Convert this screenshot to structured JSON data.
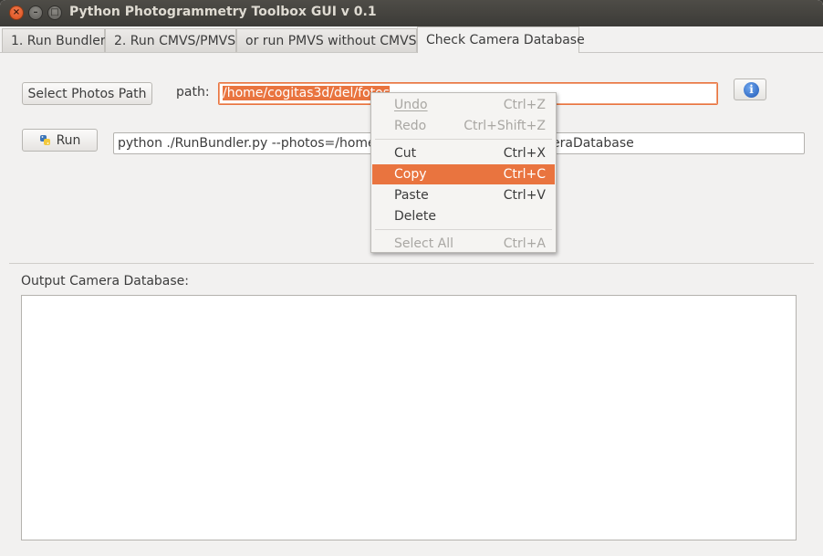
{
  "window": {
    "title": "Python Photogrammetry Toolbox GUI v 0.1",
    "controls": {
      "close": "×",
      "minimize": "–",
      "maximize": "□"
    }
  },
  "tabs": [
    {
      "label": "1. Run Bundler"
    },
    {
      "label": "2. Run CMVS/PMVS"
    },
    {
      "label": "or run PMVS without CMVS"
    },
    {
      "label": "Check Camera Database",
      "active": true
    }
  ],
  "form": {
    "select_button": "Select Photos Path",
    "path_label": "path:",
    "path_value": "/home/cogitas3d/del/fotos",
    "info_icon": "info-icon",
    "run_button": "Run",
    "run_icon": "python-icon",
    "command_left": "python ./RunBundler.py --photos=/home/c",
    "command_right": "eraDatabase"
  },
  "output": {
    "label": "Output Camera Database:",
    "text": ""
  },
  "context_menu": {
    "items": [
      {
        "label": "Undo",
        "accel": "Ctrl+Z",
        "enabled": false
      },
      {
        "label": "Redo",
        "accel": "Ctrl+Shift+Z",
        "enabled": false
      },
      {
        "label": "Cut",
        "accel": "Ctrl+X",
        "enabled": true
      },
      {
        "label": "Copy",
        "accel": "Ctrl+C",
        "enabled": true,
        "highlighted": true
      },
      {
        "label": "Paste",
        "accel": "Ctrl+V",
        "enabled": true
      },
      {
        "label": "Delete",
        "accel": "",
        "enabled": true
      },
      {
        "label": "Select All",
        "accel": "Ctrl+A",
        "enabled": false
      }
    ]
  },
  "colors": {
    "accent": "#e9743f",
    "titlebar": "#3c3b37",
    "background": "#f2f1f0"
  }
}
